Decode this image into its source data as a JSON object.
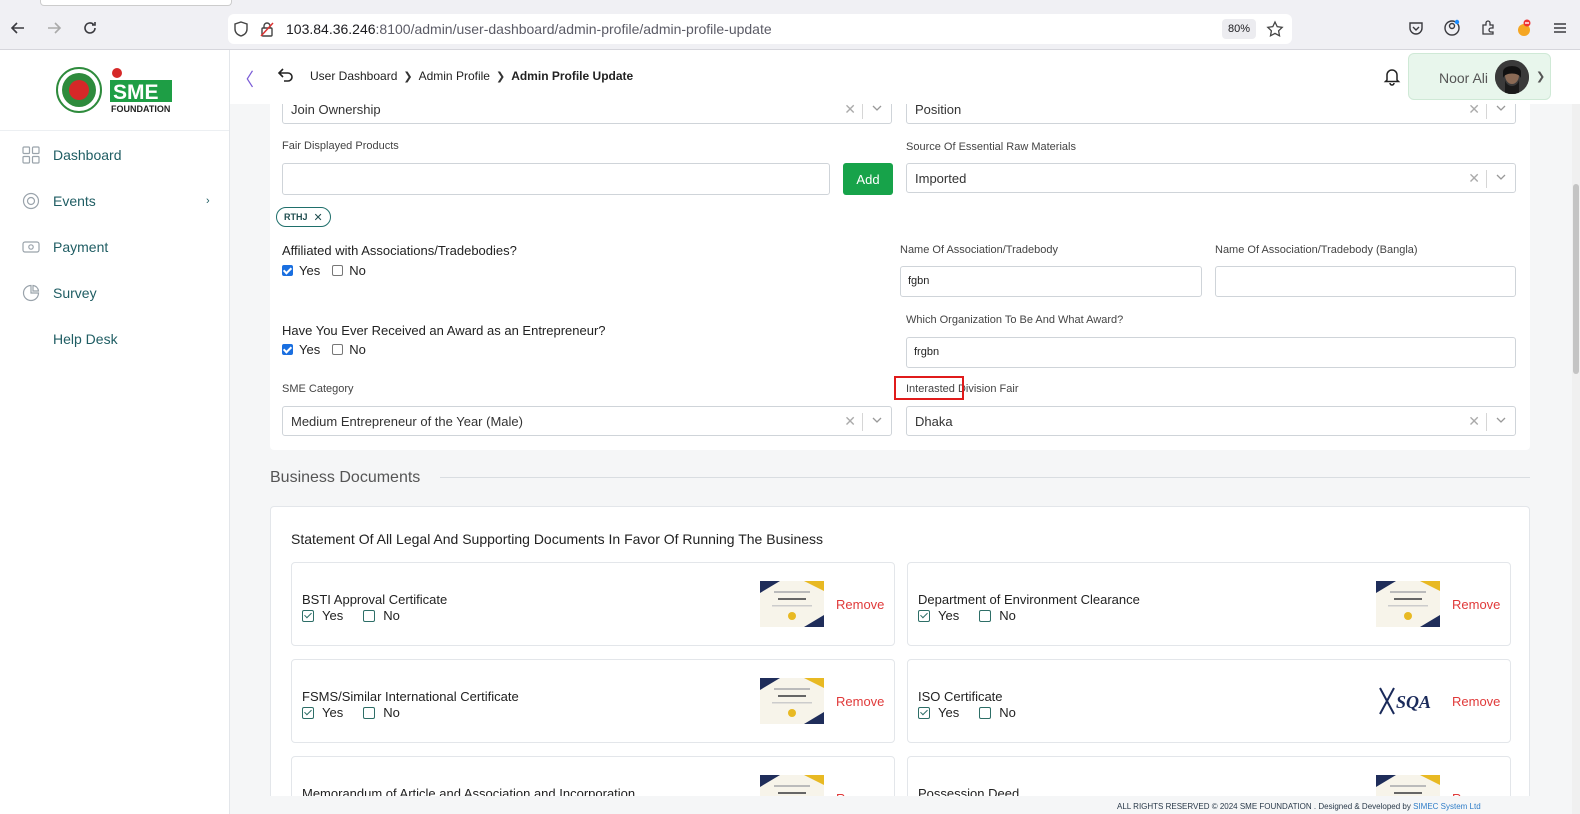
{
  "browser": {
    "url_host": "103.84.36.246",
    "url_rest": ":8100/admin/user-dashboard/admin-profile/admin-profile-update",
    "zoom": "80%"
  },
  "sidebar": {
    "items": [
      {
        "label": "Dashboard",
        "icon": "grid-icon"
      },
      {
        "label": "Events",
        "icon": "events-icon",
        "chevron": "›"
      },
      {
        "label": "Payment",
        "icon": "payment-icon"
      },
      {
        "label": "Survey",
        "icon": "pie-icon"
      },
      {
        "label": "Help Desk",
        "icon": ""
      }
    ]
  },
  "topbar": {
    "collapse": "〈",
    "breadcrumb": [
      "User Dashboard",
      "Admin Profile",
      "Admin Profile Update"
    ],
    "user_name": "Noor Ali"
  },
  "form": {
    "join_ownership": "Join Ownership",
    "position": "Position",
    "fair_products_label": "Fair Displayed Products",
    "add_label": "Add",
    "raw_materials_label": "Source Of Essential Raw Materials",
    "raw_materials_value": "Imported",
    "chip": "RTHJ",
    "affiliated_q": "Affiliated with Associations/Tradebodies?",
    "yes": "Yes",
    "no": "No",
    "assoc_label": "Name Of Association/Tradebody",
    "assoc_value": "fgbn",
    "assoc_bn_label": "Name Of Association/Tradebody (Bangla)",
    "award_q": "Have You Ever Received an Award as an Entrepreneur?",
    "award_org_label": "Which Organization To Be And What Award?",
    "award_org_value": "frgbn",
    "sme_category_label": "SME Category",
    "sme_category_value": "Medium Entrepreneur of the Year (Male)",
    "division_label": "Interasted Division Fair",
    "division_value": "Dhaka"
  },
  "documents": {
    "section_title": "Business Documents",
    "card_title": "Statement Of All Legal And Supporting Documents In Favor Of Running The Business",
    "remove": "Remove",
    "items": [
      {
        "name": "BSTI Approval Certificate",
        "thumb": "certificate"
      },
      {
        "name": "Department of Environment Clearance",
        "thumb": "certificate"
      },
      {
        "name": "FSMS/Similar International Certificate",
        "thumb": "certificate"
      },
      {
        "name": "ISO Certificate",
        "thumb": "sqa-logo"
      },
      {
        "name": "Memorandum of Article and Association and Incorporation",
        "thumb": "certificate"
      },
      {
        "name": "Possession Deed",
        "thumb": "certificate"
      }
    ]
  },
  "footer": {
    "text": "ALL RIGHTS RESERVED © 2024 SME FOUNDATION . Designed & Developed by",
    "link": "SIMEC System Ltd"
  },
  "colors": {
    "accent": "#1f5d63",
    "add_button": "#17a34a",
    "remove": "#e03a3a",
    "highlight": "#e01b1b"
  }
}
